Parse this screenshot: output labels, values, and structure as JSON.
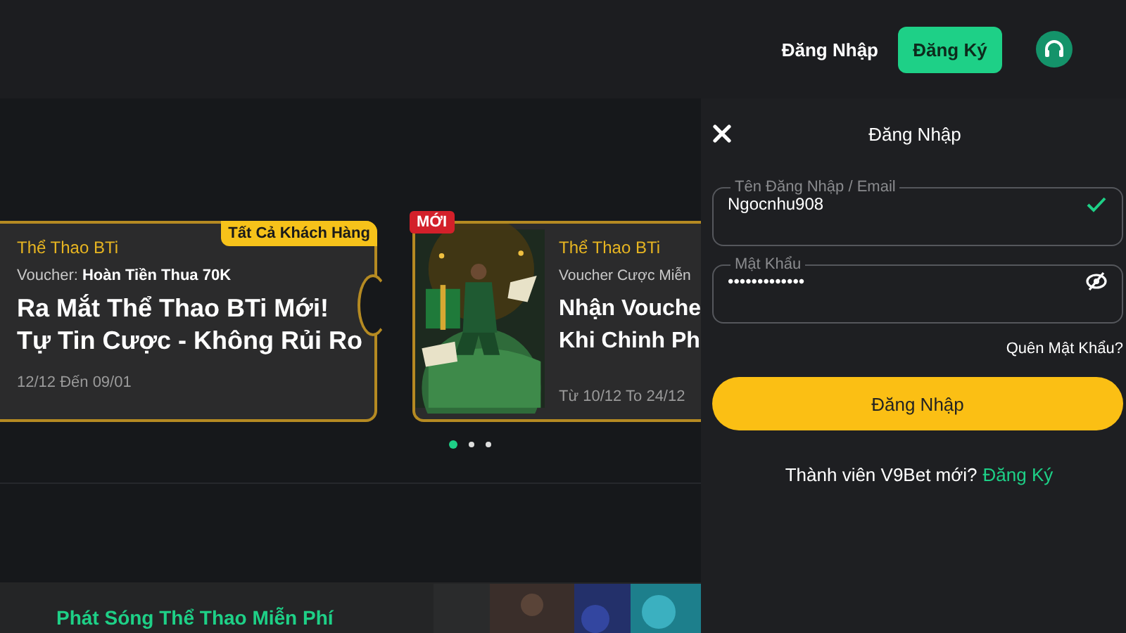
{
  "header": {
    "login_link": "Đăng Nhập",
    "register_button": "Đăng Ký"
  },
  "promotions": [
    {
      "kind": "ticket",
      "badge": "Tất Cả Khách Hàng",
      "category": "Thể Thao BTi",
      "voucher_label": "Voucher:",
      "voucher_value": "Hoàn Tiền Thua 70K",
      "title": "Ra Mắt Thể Thao BTi Mới!",
      "subtitle": "Tự Tin Cược - Không Rủi Ro",
      "dates": "12/12 Đến 09/01"
    },
    {
      "badge": "MỚI",
      "category": "Thể Thao BTi",
      "voucher_label": "Voucher Cược Miễn",
      "title": "Nhận Vouche",
      "subtitle": "Khi Chinh Ph",
      "dates": "Từ 10/12 To 24/12"
    }
  ],
  "carousel_dots": [
    {
      "selected": true
    },
    {
      "selected": false
    },
    {
      "selected": false
    }
  ],
  "banner": {
    "title": "Phát Sóng Thể Thao Miễn Phí"
  },
  "login_panel": {
    "title": "Đăng Nhập",
    "username": {
      "label": "Tên Đăng Nhập / Email",
      "value": "Ngocnhu908",
      "valid": true
    },
    "password": {
      "label": "Mật Khẩu",
      "value": "•••••••••••••"
    },
    "forgot": "Quên Mật Khẩu?",
    "submit": "Đăng Nhập",
    "signup_prompt": "Thành viên V9Bet mới?",
    "signup_link": "Đăng Ký"
  }
}
